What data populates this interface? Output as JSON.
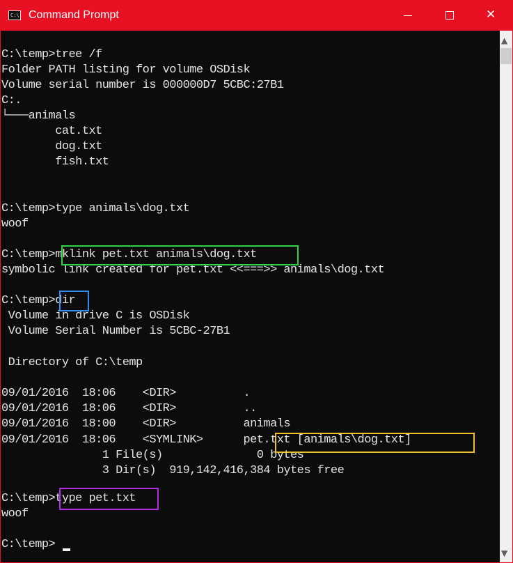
{
  "window": {
    "title": "Command Prompt",
    "icon": "cmd-icon",
    "icon_text": "C:\\."
  },
  "controls": {
    "minimize_icon": "minimize-icon",
    "maximize_icon": "maximize-icon",
    "close_icon": "close-icon",
    "close_glyph": "✕"
  },
  "colors": {
    "titlebar": "#e81123",
    "console_bg": "#0c0c0c",
    "text": "#e4e4e4",
    "hl_green": "#2ed243",
    "hl_blue": "#2f8ef0",
    "hl_yellow": "#f1c12c",
    "hl_purple": "#b22ee3"
  },
  "console": {
    "lines": [
      "C:\\temp>tree /f",
      "Folder PATH listing for volume OSDisk",
      "Volume serial number is 000000D7 5CBC:27B1",
      "C:.",
      "└───animals",
      "        cat.txt",
      "        dog.txt",
      "        fish.txt",
      "C:\\temp>type animals\\dog.txt",
      "woof",
      "C:\\temp>mklink pet.txt animals\\dog.txt",
      "symbolic link created for pet.txt <<===>> animals\\dog.txt",
      "C:\\temp>dir",
      " Volume in drive C is OSDisk",
      " Volume Serial Number is 5CBC-27B1",
      " Directory of C:\\temp",
      "09/01/2016  18:06    <DIR>          .",
      "09/01/2016  18:06    <DIR>          ..",
      "09/01/2016  18:00    <DIR>          animals",
      "09/01/2016  18:06    <SYMLINK>      pet.txt [animals\\dog.txt]",
      "               1 File(s)              0 bytes",
      "               3 Dir(s)  919,142,416,384 bytes free",
      "C:\\temp>type pet.txt",
      "woof",
      "C:\\temp>"
    ]
  },
  "scrollbar": {
    "up_glyph": "▲",
    "down_glyph": "▼"
  }
}
